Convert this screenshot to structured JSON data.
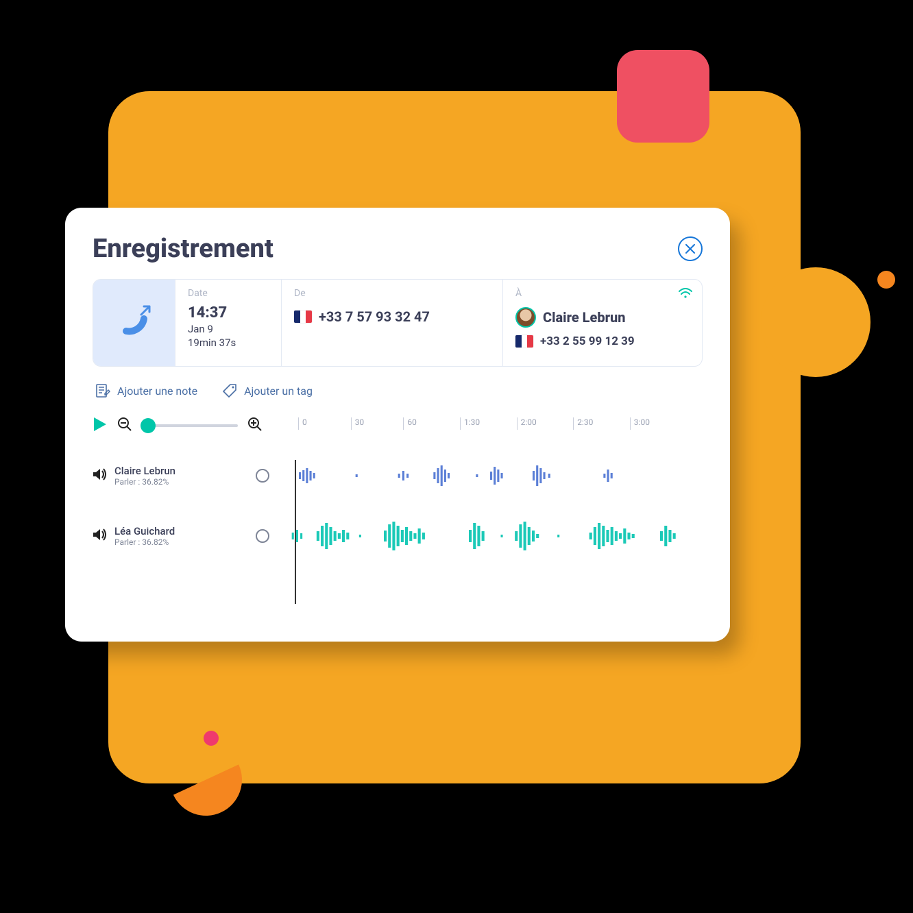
{
  "title": "Enregistrement",
  "call": {
    "date_label": "Date",
    "time": "14:37",
    "day": "Jan 9",
    "duration": "19min 37s",
    "from_label": "De",
    "from_number": "+33 7 57 93 32 47",
    "to_label": "À",
    "to_name": "Claire Lebrun",
    "to_number": "+33 2 55 99 12 39"
  },
  "actions": {
    "add_note": "Ajouter une note",
    "add_tag": "Ajouter un tag"
  },
  "timeline": {
    "ticks": [
      "0",
      "30",
      "60",
      "1:30",
      "2:00",
      "2:30",
      "3:00"
    ]
  },
  "speakers": [
    {
      "name": "Claire Lebrun",
      "talk_label": "Parler : 36.82%",
      "color": "#5B7FD6"
    },
    {
      "name": "Léa Guichard",
      "talk_label": "Parler : 36.82%",
      "color": "#1BC9B7"
    }
  ],
  "colors": {
    "accent": "#00C6A9",
    "primary_blue": "#1676D8",
    "bg_orange": "#F5A623"
  }
}
